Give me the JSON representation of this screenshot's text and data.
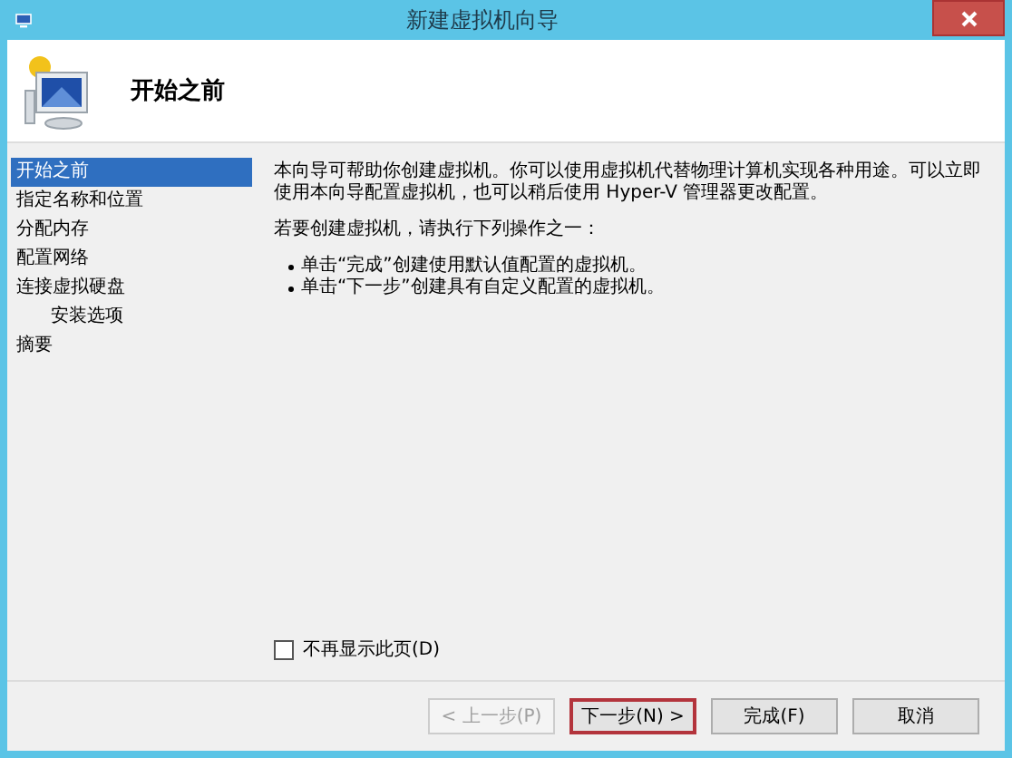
{
  "window": {
    "title": "新建虚拟机向导"
  },
  "header": {
    "title": "开始之前"
  },
  "sidebar": {
    "items": [
      {
        "label": "开始之前",
        "selected": true
      },
      {
        "label": "指定名称和位置",
        "selected": false
      },
      {
        "label": "分配内存",
        "selected": false
      },
      {
        "label": "配置网络",
        "selected": false
      },
      {
        "label": "连接虚拟硬盘",
        "selected": false,
        "children": [
          {
            "label": "安装选项",
            "selected": false
          }
        ]
      },
      {
        "label": "摘要",
        "selected": false
      }
    ]
  },
  "content": {
    "paragraphs": [
      "本向导可帮助你创建虚拟机。你可以使用虚拟机代替物理计算机实现各种用途。可以立即使用本向导配置虚拟机，也可以稍后使用 Hyper-V 管理器更改配置。",
      "若要创建虚拟机，请执行下列操作之一："
    ],
    "bullets": [
      "单击“完成”创建使用默认值配置的虚拟机。",
      "单击“下一步”创建具有自定义配置的虚拟机。"
    ],
    "checkbox": {
      "label": "不再显示此页(D)",
      "checked": false
    }
  },
  "buttons": [
    {
      "label": "< 上一步(P)",
      "disabled": true,
      "default": false
    },
    {
      "label": "下一步(N) >",
      "disabled": false,
      "default": true
    },
    {
      "label": "完成(F)",
      "disabled": false,
      "default": false
    },
    {
      "label": "取消",
      "disabled": false,
      "default": false
    }
  ]
}
